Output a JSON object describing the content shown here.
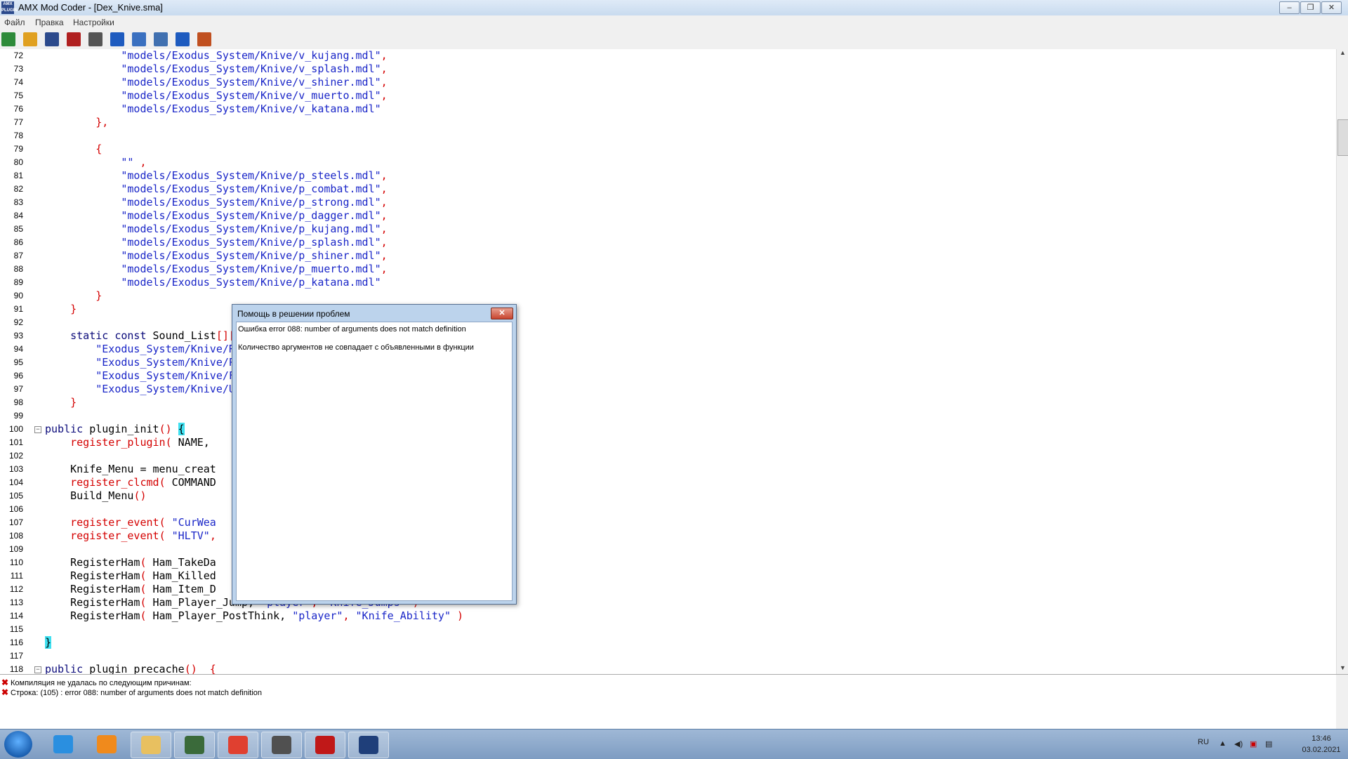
{
  "window": {
    "title": "AMX Mod Coder - [Dex_Knive.sma]",
    "min": "–",
    "max": "❐",
    "close": "✕",
    "app_icon": "AMX\nPLUGIN"
  },
  "menu": {
    "file": "Файл",
    "edit": "Правка",
    "settings": "Настройки"
  },
  "toolbar": [
    {
      "name": "new-icon",
      "color": "#2e8b3a"
    },
    {
      "name": "open-icon",
      "color": "#e0a020"
    },
    {
      "name": "save-icon",
      "color": "#2c4a8c"
    },
    {
      "name": "save-as-icon",
      "color": "#b02020"
    },
    {
      "name": "find-icon",
      "color": "#555555"
    },
    {
      "name": "compile-icon",
      "color": "#1e5bbf"
    },
    {
      "name": "settings-icon",
      "color": "#3a70c0"
    },
    {
      "name": "convert-icon",
      "color": "#4070b0"
    },
    {
      "name": "help-icon",
      "color": "#1e5bbf"
    },
    {
      "name": "exit-icon",
      "color": "#c05020"
    }
  ],
  "code_lines": [
    {
      "n": "72",
      "t": [
        {
          "c": "str",
          "s": "            \"models/Exodus_System/Knive/v_kujang.mdl\""
        },
        {
          "c": "pn",
          "s": ","
        }
      ]
    },
    {
      "n": "73",
      "t": [
        {
          "c": "str",
          "s": "            \"models/Exodus_System/Knive/v_splash.mdl\""
        },
        {
          "c": "pn",
          "s": ","
        }
      ]
    },
    {
      "n": "74",
      "t": [
        {
          "c": "str",
          "s": "            \"models/Exodus_System/Knive/v_shiner.mdl\""
        },
        {
          "c": "pn",
          "s": ","
        }
      ]
    },
    {
      "n": "75",
      "t": [
        {
          "c": "str",
          "s": "            \"models/Exodus_System/Knive/v_muerto.mdl\""
        },
        {
          "c": "pn",
          "s": ","
        }
      ]
    },
    {
      "n": "76",
      "t": [
        {
          "c": "str",
          "s": "            \"models/Exodus_System/Knive/v_katana.mdl\""
        }
      ]
    },
    {
      "n": "77",
      "t": [
        {
          "c": "pn",
          "s": "        },"
        }
      ]
    },
    {
      "n": "78",
      "t": []
    },
    {
      "n": "79",
      "t": [
        {
          "c": "pn",
          "s": "        {"
        }
      ]
    },
    {
      "n": "80",
      "t": [
        {
          "c": "str",
          "s": "            \"\""
        },
        {
          "c": "pn",
          "s": " ,"
        }
      ]
    },
    {
      "n": "81",
      "t": [
        {
          "c": "str",
          "s": "            \"models/Exodus_System/Knive/p_steels.mdl\""
        },
        {
          "c": "pn",
          "s": ","
        }
      ]
    },
    {
      "n": "82",
      "t": [
        {
          "c": "str",
          "s": "            \"models/Exodus_System/Knive/p_combat.mdl\""
        },
        {
          "c": "pn",
          "s": ","
        }
      ]
    },
    {
      "n": "83",
      "t": [
        {
          "c": "str",
          "s": "            \"models/Exodus_System/Knive/p_strong.mdl\""
        },
        {
          "c": "pn",
          "s": ","
        }
      ]
    },
    {
      "n": "84",
      "t": [
        {
          "c": "str",
          "s": "            \"models/Exodus_System/Knive/p_dagger.mdl\""
        },
        {
          "c": "pn",
          "s": ","
        }
      ]
    },
    {
      "n": "85",
      "t": [
        {
          "c": "str",
          "s": "            \"models/Exodus_System/Knive/p_kujang.mdl\""
        },
        {
          "c": "pn",
          "s": ","
        }
      ]
    },
    {
      "n": "86",
      "t": [
        {
          "c": "str",
          "s": "            \"models/Exodus_System/Knive/p_splash.mdl\""
        },
        {
          "c": "pn",
          "s": ","
        }
      ]
    },
    {
      "n": "87",
      "t": [
        {
          "c": "str",
          "s": "            \"models/Exodus_System/Knive/p_shiner.mdl\""
        },
        {
          "c": "pn",
          "s": ","
        }
      ]
    },
    {
      "n": "88",
      "t": [
        {
          "c": "str",
          "s": "            \"models/Exodus_System/Knive/p_muerto.mdl\""
        },
        {
          "c": "pn",
          "s": ","
        }
      ]
    },
    {
      "n": "89",
      "t": [
        {
          "c": "str",
          "s": "            \"models/Exodus_System/Knive/p_katana.mdl\""
        }
      ]
    },
    {
      "n": "90",
      "t": [
        {
          "c": "pn",
          "s": "        }"
        }
      ]
    },
    {
      "n": "91",
      "t": [
        {
          "c": "pn",
          "s": "    }"
        }
      ]
    },
    {
      "n": "92",
      "t": []
    },
    {
      "n": "93",
      "t": [
        {
          "c": "kw",
          "s": "    static const "
        },
        {
          "c": "ident",
          "s": "Sound_List"
        },
        {
          "c": "pn",
          "s": "[][]"
        }
      ]
    },
    {
      "n": "94",
      "t": [
        {
          "c": "str",
          "s": "        \"Exodus_System/Knive/Re"
        }
      ]
    },
    {
      "n": "95",
      "t": [
        {
          "c": "str",
          "s": "        \"Exodus_System/Knive/Po"
        }
      ]
    },
    {
      "n": "96",
      "t": [
        {
          "c": "str",
          "s": "        \"Exodus_System/Knive/Fr"
        }
      ]
    },
    {
      "n": "97",
      "t": [
        {
          "c": "str",
          "s": "        \"Exodus_System/Knive/Un"
        }
      ]
    },
    {
      "n": "98",
      "t": [
        {
          "c": "pn",
          "s": "    }"
        }
      ]
    },
    {
      "n": "99",
      "t": []
    },
    {
      "n": "100",
      "fold": "⊟",
      "t": [
        {
          "c": "kw",
          "s": "public "
        },
        {
          "c": "ident",
          "s": "plugin_init"
        },
        {
          "c": "pn",
          "s": "() "
        },
        {
          "c": "hl",
          "s": "{"
        }
      ]
    },
    {
      "n": "101",
      "t": [
        {
          "c": "fn",
          "s": "    register_plugin"
        },
        {
          "c": "pn",
          "s": "( "
        },
        {
          "c": "ident",
          "s": "NAME,"
        }
      ]
    },
    {
      "n": "102",
      "t": []
    },
    {
      "n": "103",
      "t": [
        {
          "c": "ident",
          "s": "    Knife_Menu = menu_creat"
        }
      ]
    },
    {
      "n": "104",
      "t": [
        {
          "c": "fn",
          "s": "    register_clcmd"
        },
        {
          "c": "pn",
          "s": "( "
        },
        {
          "c": "ident",
          "s": "COMMAND"
        },
        {
          "c": "ident",
          "s": "                                 "
        },
        {
          "c": "str",
          "s": "Menu\""
        },
        {
          "c": "pn",
          "s": " )"
        }
      ]
    },
    {
      "n": "105",
      "t": [
        {
          "c": "ident",
          "s": "    Build_Menu"
        },
        {
          "c": "pn",
          "s": "()"
        }
      ]
    },
    {
      "n": "106",
      "t": []
    },
    {
      "n": "107",
      "t": [
        {
          "c": "fn",
          "s": "    register_event"
        },
        {
          "c": "pn",
          "s": "( "
        },
        {
          "c": "str",
          "s": "\"CurWea"
        }
      ]
    },
    {
      "n": "108",
      "t": [
        {
          "c": "fn",
          "s": "    register_event"
        },
        {
          "c": "pn",
          "s": "( "
        },
        {
          "c": "str",
          "s": "\"HLTV\""
        },
        {
          "c": "pn",
          "s": ","
        }
      ]
    },
    {
      "n": "109",
      "t": []
    },
    {
      "n": "110",
      "t": [
        {
          "c": "ident",
          "s": "    RegisterHam"
        },
        {
          "c": "pn",
          "s": "( "
        },
        {
          "c": "ident",
          "s": "Ham_TakeDa"
        }
      ]
    },
    {
      "n": "111",
      "t": [
        {
          "c": "ident",
          "s": "    RegisterHam"
        },
        {
          "c": "pn",
          "s": "( "
        },
        {
          "c": "ident",
          "s": "Ham_Killed"
        }
      ]
    },
    {
      "n": "112",
      "t": [
        {
          "c": "ident",
          "s": "    RegisterHam"
        },
        {
          "c": "pn",
          "s": "( "
        },
        {
          "c": "ident",
          "s": "Ham_Item_D"
        },
        {
          "c": "ident",
          "s": "                                    "
        },
        {
          "c": "pn",
          "s": ")"
        }
      ]
    },
    {
      "n": "113",
      "t": [
        {
          "c": "ident",
          "s": "    RegisterHam"
        },
        {
          "c": "pn",
          "s": "( "
        },
        {
          "c": "ident",
          "s": "Ham_Player_Jump, "
        },
        {
          "c": "str",
          "s": "\"player\""
        },
        {
          "c": "pn",
          "s": ", "
        },
        {
          "c": "str",
          "s": "\"Knife_Jumps\""
        },
        {
          "c": "pn",
          "s": " )"
        }
      ]
    },
    {
      "n": "114",
      "t": [
        {
          "c": "ident",
          "s": "    RegisterHam"
        },
        {
          "c": "pn",
          "s": "( "
        },
        {
          "c": "ident",
          "s": "Ham_Player_PostThink, "
        },
        {
          "c": "str",
          "s": "\"player\""
        },
        {
          "c": "pn",
          "s": ", "
        },
        {
          "c": "str",
          "s": "\"Knife_Ability\""
        },
        {
          "c": "pn",
          "s": " )"
        }
      ]
    },
    {
      "n": "115",
      "t": []
    },
    {
      "n": "116",
      "t": [
        {
          "c": "hl",
          "s": "}"
        }
      ]
    },
    {
      "n": "117",
      "t": []
    },
    {
      "n": "118",
      "fold": "⊟",
      "t": [
        {
          "c": "kw",
          "s": "public "
        },
        {
          "c": "ident",
          "s": "plugin_precache"
        },
        {
          "c": "pn",
          "s": "()  {"
        }
      ]
    }
  ],
  "dialog": {
    "title": "Помощь в решении проблем",
    "close": "✕",
    "error_line": "Ошибка error 088: number of arguments does not match definition",
    "explanation": "Количество аргументов не совпадает с объявленными в функции"
  },
  "output": {
    "line1": "Компиляция не удалась по следующим причинам:",
    "line2": "Строка: (105) : error 088: number of arguments does not match definition",
    "icon": "✖"
  },
  "taskbar": {
    "items": [
      {
        "name": "ie-icon",
        "color": "#2a8fe0",
        "open": false
      },
      {
        "name": "media-player-icon",
        "color": "#f08a1c",
        "open": false
      },
      {
        "name": "explorer-icon",
        "color": "#e8c060",
        "open": true
      },
      {
        "name": "terminal-icon",
        "color": "#3a6a3a",
        "open": true
      },
      {
        "name": "chrome-icon",
        "color": "#e04030",
        "open": true
      },
      {
        "name": "cs-icon",
        "color": "#505050",
        "open": true
      },
      {
        "name": "filezilla-icon",
        "color": "#c01818",
        "open": true
      },
      {
        "name": "amx-icon",
        "color": "#1f3f7a",
        "open": true
      }
    ],
    "lang": "RU",
    "time": "13:46",
    "date": "03.02.2021"
  }
}
